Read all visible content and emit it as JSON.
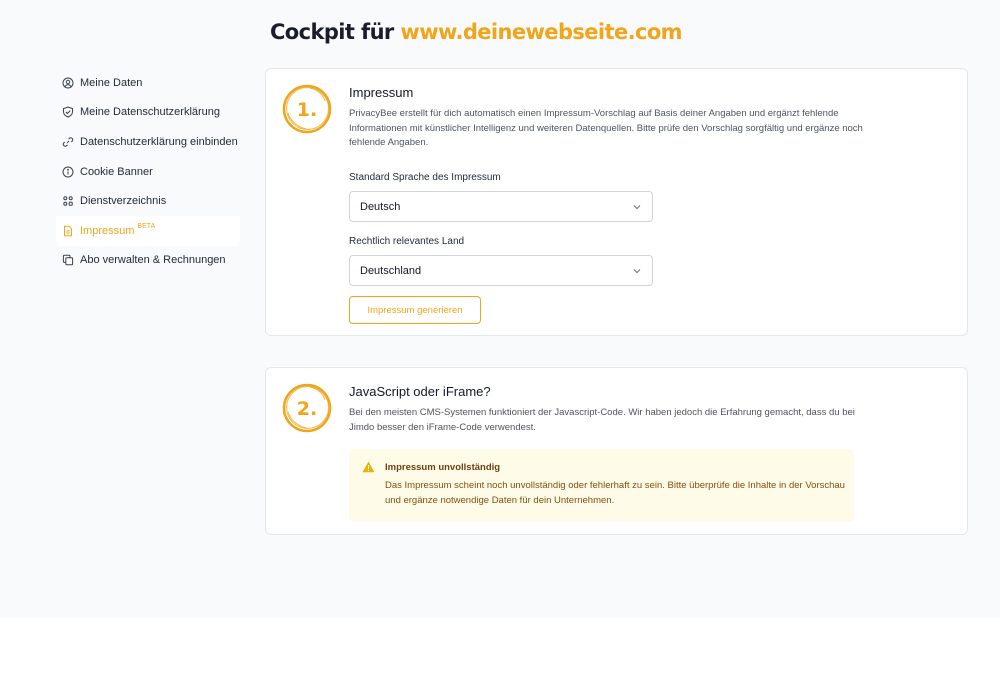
{
  "header": {
    "prefix": "Cockpit für",
    "site": "www.deinewebseite.com"
  },
  "sidebar": {
    "items": [
      {
        "label": "Meine Daten",
        "icon": "user-circle-icon"
      },
      {
        "label": "Meine Datenschutzerklärung",
        "icon": "shield-icon"
      },
      {
        "label": "Datenschutzerklärung einbinden",
        "icon": "link-icon"
      },
      {
        "label": "Cookie Banner",
        "icon": "info-icon"
      },
      {
        "label": "Dienstverzeichnis",
        "icon": "grid-icon"
      },
      {
        "label": "Impressum",
        "badge": "BETA",
        "icon": "document-icon",
        "active": true
      },
      {
        "label": "Abo verwalten & Rechnungen",
        "icon": "copy-icon"
      }
    ]
  },
  "step1": {
    "badge": "1.",
    "title": "Impressum",
    "description": "PrivacyBee erstellt für dich automatisch einen Impressum-Vorschlag auf Basis deiner Angaben und ergänzt fehlende Informationen mit künstlicher Intelligenz und weiteren Datenquellen. Bitte prüfe den Vorschlag sorgfältig und ergänze noch fehlende Angaben.",
    "language_label": "Standard Sprache des Impressum",
    "language_value": "Deutsch",
    "country_label": "Rechtlich relevantes Land",
    "country_value": "Deutschland",
    "generate_button": "Impressum generieren"
  },
  "step2": {
    "badge": "2.",
    "title": "JavaScript oder iFrame?",
    "description": "Bei den meisten CMS-Systemen funktioniert der Javascript-Code. Wir haben jedoch die Erfahrung gemacht, dass du bei Jimdo besser den iFrame-Code verwendest.",
    "alert_title": "Impressum unvollständig",
    "alert_text": "Das Impressum scheint noch unvollständig oder fehlerhaft zu sein. Bitte überprüfe die Inhalte in der Vorschau und ergänze notwendige Daten für dein Unternehmen."
  },
  "colors": {
    "accent": "#f0a51a",
    "alert_bg": "#fefce8",
    "alert_text": "#854d0e"
  }
}
